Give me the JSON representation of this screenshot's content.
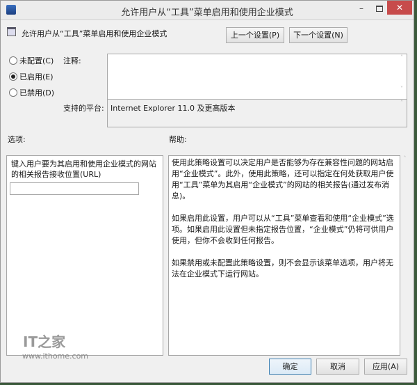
{
  "window": {
    "title": "允许用户从“工具”菜单启用和使用企业模式",
    "minimize": "–",
    "close": "✕"
  },
  "header": {
    "policy_name": "允许用户从“工具”菜单启用和使用企业模式",
    "prev_button": "上一个设置(P)",
    "next_button": "下一个设置(N)"
  },
  "state": {
    "options": [
      {
        "label": "未配置(C)",
        "checked": false
      },
      {
        "label": "已启用(E)",
        "checked": true
      },
      {
        "label": "已禁用(D)",
        "checked": false
      }
    ]
  },
  "comment": {
    "label": "注释:",
    "value": ""
  },
  "platform": {
    "label": "支持的平台:",
    "value": "Internet Explorer 11.0 及更高版本"
  },
  "options_panel": {
    "label": "选项:",
    "field_label": "键入用户要为其启用和使用企业模式的网站的相关报告接收位置(URL)",
    "field_value": ""
  },
  "help_panel": {
    "label": "帮助:",
    "paragraphs": [
      "使用此策略设置可以决定用户是否能够为存在兼容性问题的网站启用“企业模式”。此外，使用此策略，还可以指定在何处获取用户使用“工具”菜单为其启用“企业模式”的网站的相关报告(通过发布消息)。",
      "如果启用此设置，用户可以从“工具”菜单查看和使用“企业模式”选项。如果启用此设置但未指定报告位置，“企业模式”仍将可供用户使用，但你不会收到任何报告。",
      "如果禁用或未配置此策略设置，则不会显示该菜单选项，用户将无法在企业模式下运行网站。"
    ]
  },
  "footer": {
    "ok": "确定",
    "cancel": "取消",
    "apply": "应用(A)"
  },
  "watermark": {
    "logo": "IT之家",
    "url": "www.ithome.com"
  }
}
